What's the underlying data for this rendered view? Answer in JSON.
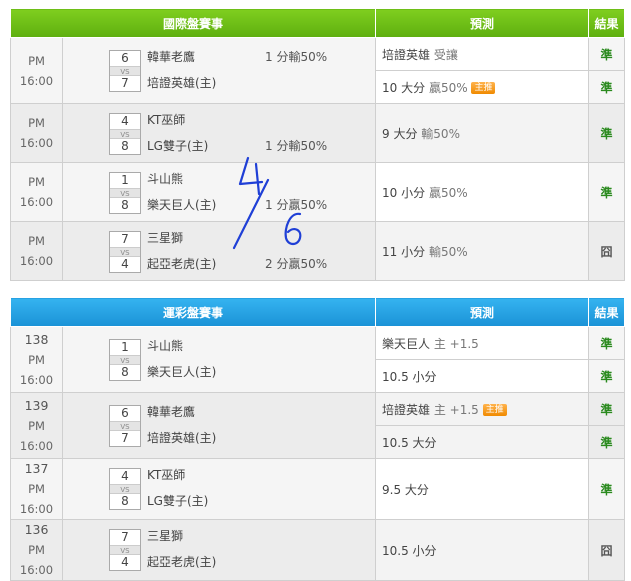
{
  "international": {
    "header": {
      "match": "國際盤賽事",
      "prediction": "預測",
      "result": "結果"
    },
    "rows": [
      {
        "time": "PM 16:00",
        "home": "韓華老鷹",
        "away": "培證英雄(主)",
        "score_home": "6",
        "score_away": "7",
        "odds": "1 分輸50%",
        "preds": [
          {
            "text": "培證英雄",
            "dim": "受讓",
            "tag": "",
            "result": "準"
          },
          {
            "text": "10 大分",
            "dim": "贏50%",
            "tag": "主推",
            "result": "準"
          }
        ]
      },
      {
        "time": "PM 16:00",
        "home": "KT巫師",
        "away": "LG雙子(主)",
        "score_home": "4",
        "score_away": "8",
        "odds": "1 分輸50%",
        "preds": [
          {
            "text": "9 大分",
            "dim": "輸50%",
            "tag": "",
            "result": "準"
          }
        ]
      },
      {
        "time": "PM 16:00",
        "home": "斗山熊",
        "away": "樂天巨人(主)",
        "score_home": "1",
        "score_away": "8",
        "odds": "1 分贏50%",
        "preds": [
          {
            "text": "10 小分",
            "dim": "贏50%",
            "tag": "",
            "result": "準"
          }
        ]
      },
      {
        "time": "PM 16:00",
        "home": "三星獅",
        "away": "起亞老虎(主)",
        "score_home": "7",
        "score_away": "4",
        "odds": "2 分贏50%",
        "preds": [
          {
            "text": "11 小分",
            "dim": "輸50%",
            "tag": "",
            "result": "囧"
          }
        ]
      }
    ]
  },
  "sports_lottery": {
    "header": {
      "match": "運彩盤賽事",
      "prediction": "預測",
      "result": "結果"
    },
    "rows": [
      {
        "num": "138",
        "time": "PM 16:00",
        "home": "斗山熊",
        "away": "樂天巨人(主)",
        "score_home": "1",
        "score_away": "8",
        "preds": [
          {
            "text": "樂天巨人",
            "dim": "主 +1.5",
            "tag": "",
            "result": "準"
          },
          {
            "text": "10.5 小分",
            "dim": "",
            "tag": "",
            "result": "準"
          }
        ]
      },
      {
        "num": "139",
        "time": "PM 16:00",
        "home": "韓華老鷹",
        "away": "培證英雄(主)",
        "score_home": "6",
        "score_away": "7",
        "preds": [
          {
            "text": "培證英雄",
            "dim": "主 +1.5",
            "tag": "主推",
            "result": "準"
          },
          {
            "text": "10.5 大分",
            "dim": "",
            "tag": "",
            "result": "準"
          }
        ]
      },
      {
        "num": "137",
        "time": "PM 16:00",
        "home": "KT巫師",
        "away": "LG雙子(主)",
        "score_home": "4",
        "score_away": "8",
        "preds": [
          {
            "text": "9.5 大分",
            "dim": "",
            "tag": "",
            "result": "準"
          }
        ]
      },
      {
        "num": "136",
        "time": "PM 16:00",
        "home": "三星獅",
        "away": "起亞老虎(主)",
        "score_home": "7",
        "score_away": "4",
        "preds": [
          {
            "text": "10.5 小分",
            "dim": "",
            "tag": "",
            "result": "囧"
          }
        ]
      }
    ]
  },
  "vs_label": "VS",
  "handwriting": {
    "color": "#1f3fd6"
  }
}
